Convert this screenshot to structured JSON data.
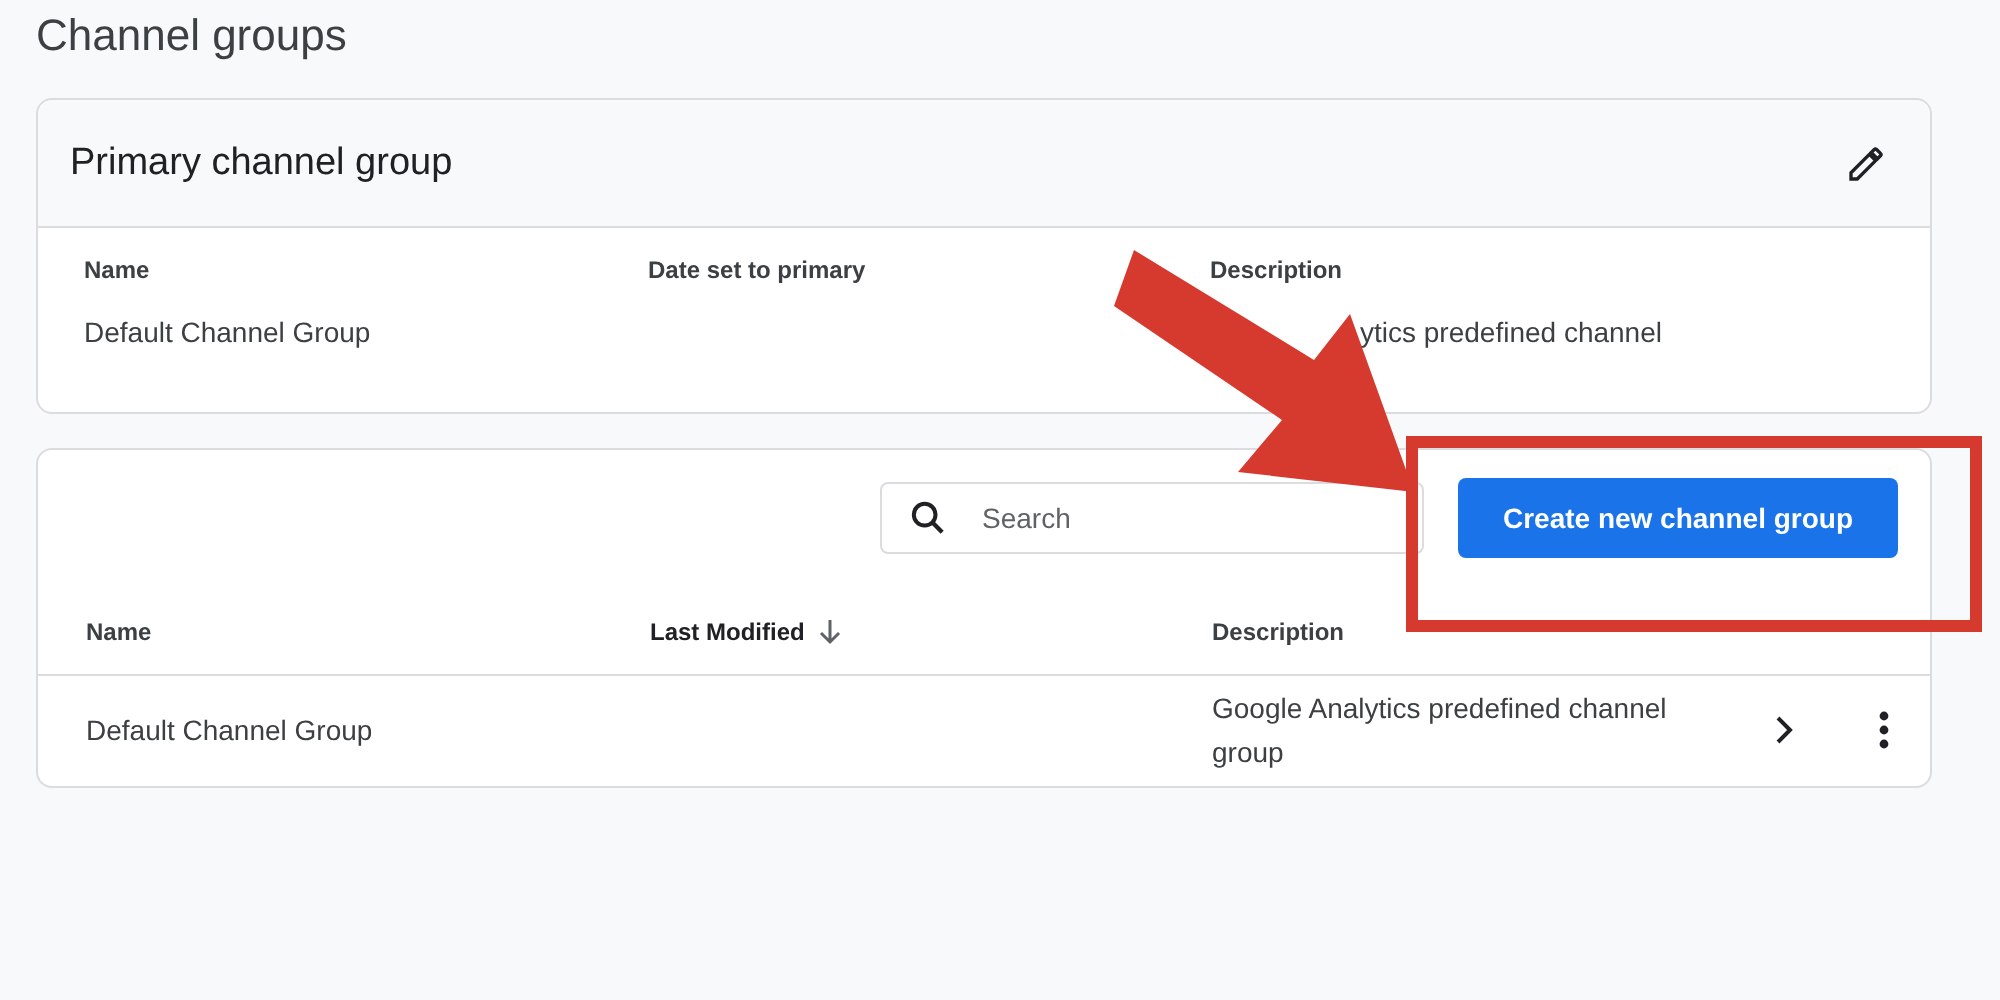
{
  "page": {
    "title": "Channel groups"
  },
  "primary_card": {
    "title": "Primary channel group",
    "columns": [
      "Name",
      "Date set to primary",
      "Description"
    ],
    "row": {
      "name": "Default Channel Group",
      "description_visible": "ytics predefined channel"
    }
  },
  "groups_card": {
    "search": {
      "placeholder": "Search"
    },
    "create_button": "Create new channel group",
    "columns": [
      {
        "label": "Name",
        "sorted": false
      },
      {
        "label": "Last Modified",
        "sorted": true
      },
      {
        "label": "Description",
        "sorted": false
      }
    ],
    "rows": [
      {
        "name": "Default Channel Group",
        "description": "Google Analytics predefined channel group"
      }
    ]
  },
  "annotation": {
    "arrow": true,
    "highlight_box": true
  }
}
